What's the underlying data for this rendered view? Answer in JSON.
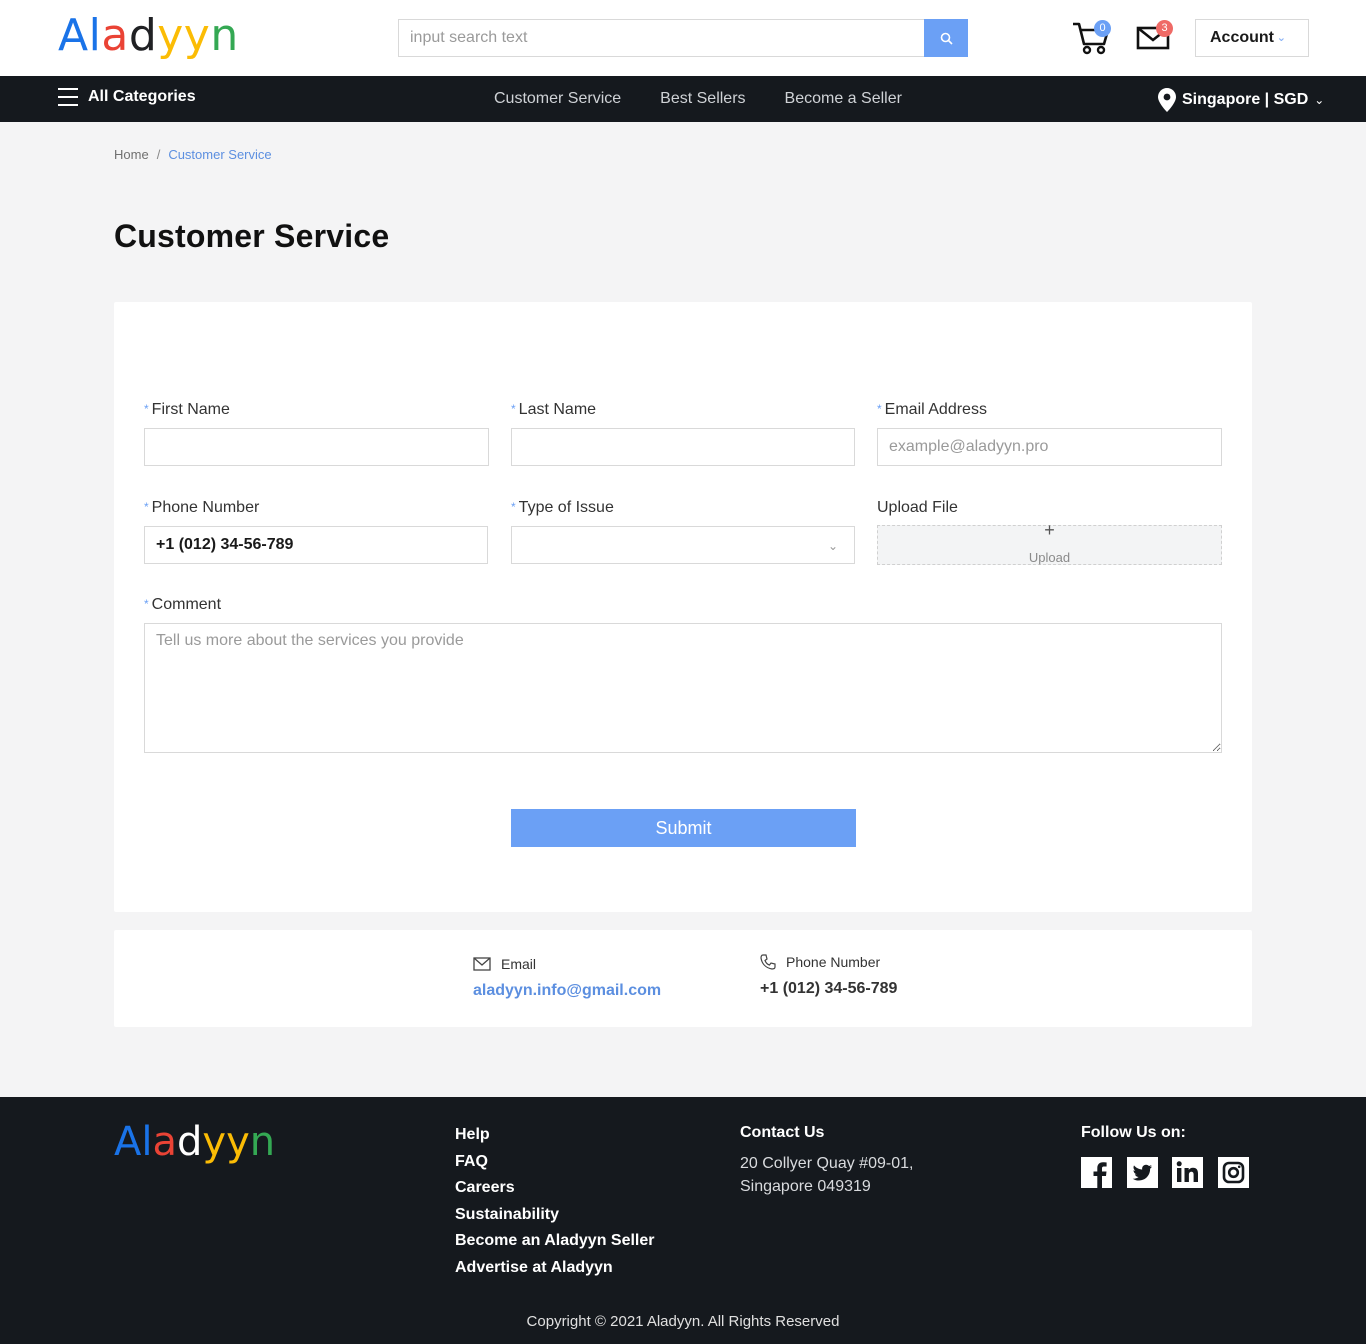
{
  "brand": {
    "name_letters": [
      "A",
      "l",
      "a",
      "d",
      "y",
      "y",
      "n"
    ],
    "colors": [
      "#1a73e8",
      "#1a73e8",
      "#ea4335",
      "#202124",
      "#fbbc05",
      "#fbbc05",
      "#34a853"
    ]
  },
  "header": {
    "search": {
      "placeholder": "input search text"
    },
    "cart_count": "0",
    "mail_count": "3",
    "account_label": "Account"
  },
  "nav": {
    "all_categories": "All Categories",
    "links": [
      "Customer Service",
      "Best Sellers",
      "Become a Seller"
    ],
    "locale": "Singapore | SGD"
  },
  "breadcrumb": {
    "home": "Home",
    "separator": "/",
    "current": "Customer Service"
  },
  "page": {
    "title": "Customer Service"
  },
  "form": {
    "first_name": {
      "label": "First Name",
      "value": ""
    },
    "last_name": {
      "label": "Last Name",
      "value": ""
    },
    "email": {
      "label": "Email Address",
      "placeholder": "example@aladyyn.pro"
    },
    "phone": {
      "label": "Phone Number",
      "value": "+1 (012) 34-56-789"
    },
    "issue_type": {
      "label": "Type of Issue",
      "value": ""
    },
    "upload": {
      "label": "Upload File",
      "plus": "+",
      "button": "Upload"
    },
    "comment": {
      "label": "Comment",
      "placeholder": "Tell us more about the services you provide"
    },
    "required_mark": "*",
    "submit_label": "Submit"
  },
  "contact": {
    "email": {
      "heading": "Email",
      "value": "aladyyn.info@gmail.com"
    },
    "phone": {
      "heading": "Phone Number",
      "value": "+1 (012) 34-56-789"
    }
  },
  "footer": {
    "links": [
      "Help",
      "FAQ",
      "Careers",
      "Sustainability",
      "Become an Aladyyn Seller",
      "Advertise at Aladyyn"
    ],
    "contact_heading": "Contact Us",
    "address_line1": "20 Collyer Quay #09-01,",
    "address_line2": "Singapore 049319",
    "follow_heading": "Follow Us on:",
    "social_icons": [
      "facebook-icon",
      "twitter-icon",
      "linkedin-icon",
      "instagram-icon"
    ],
    "copyright": "Copyright © 2021 Aladyyn. All Rights Reserved"
  },
  "colors": {
    "accent": "#6ba0f5",
    "dark": "#15191e",
    "badge_red": "#ef6a66",
    "link_blue": "#5c8fe0"
  }
}
